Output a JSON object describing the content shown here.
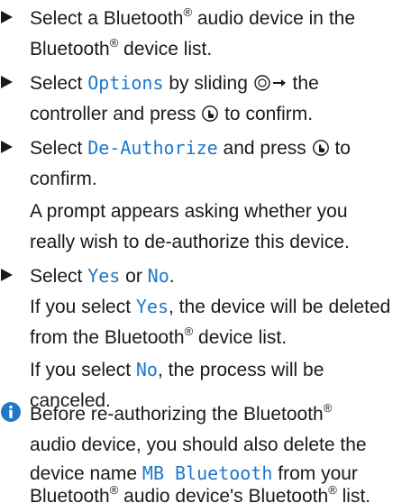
{
  "trademark": "®",
  "step1": {
    "line1_pre": "Select a Bluetooth",
    "line1_post": " audio device in the",
    "line2_pre": "Bluetooth",
    "line2_post": " device list."
  },
  "step2": {
    "select": "Select ",
    "options": "Options",
    "by_sliding": " by sliding ",
    "the": " the",
    "line2_pre": "controller and press ",
    "line2_post": " to confirm."
  },
  "step3": {
    "select": "Select ",
    "deauth": "De-Authorize",
    "and_press": " and press ",
    "to": " to",
    "confirm": "confirm.",
    "prompt_line1": "A prompt appears asking whether you",
    "prompt_line2": "really wish to de-authorize this device."
  },
  "step4": {
    "select": "Select ",
    "yes": "Yes",
    "or": " or ",
    "no": "No",
    "period": ".",
    "if_select": "If you select ",
    "yes_result": ", the device will be deleted",
    "from_pre": "from the Bluetooth",
    "from_post": " device list.",
    "no_result": ", the process will be",
    "canceled": "canceled."
  },
  "note": {
    "line1_pre": "Before re-authorizing the Bluetooth",
    "line2": "audio device, you should also delete the",
    "line3_pre": "device name ",
    "device_name": "MB Bluetooth",
    "line3_post": " from your",
    "line4_a": "Bluetooth",
    "line4_b": " audio device's Bluetooth",
    "line4_c": " list."
  },
  "colors": {
    "text": "#1a1a1a",
    "accent": "#1e78c8"
  }
}
